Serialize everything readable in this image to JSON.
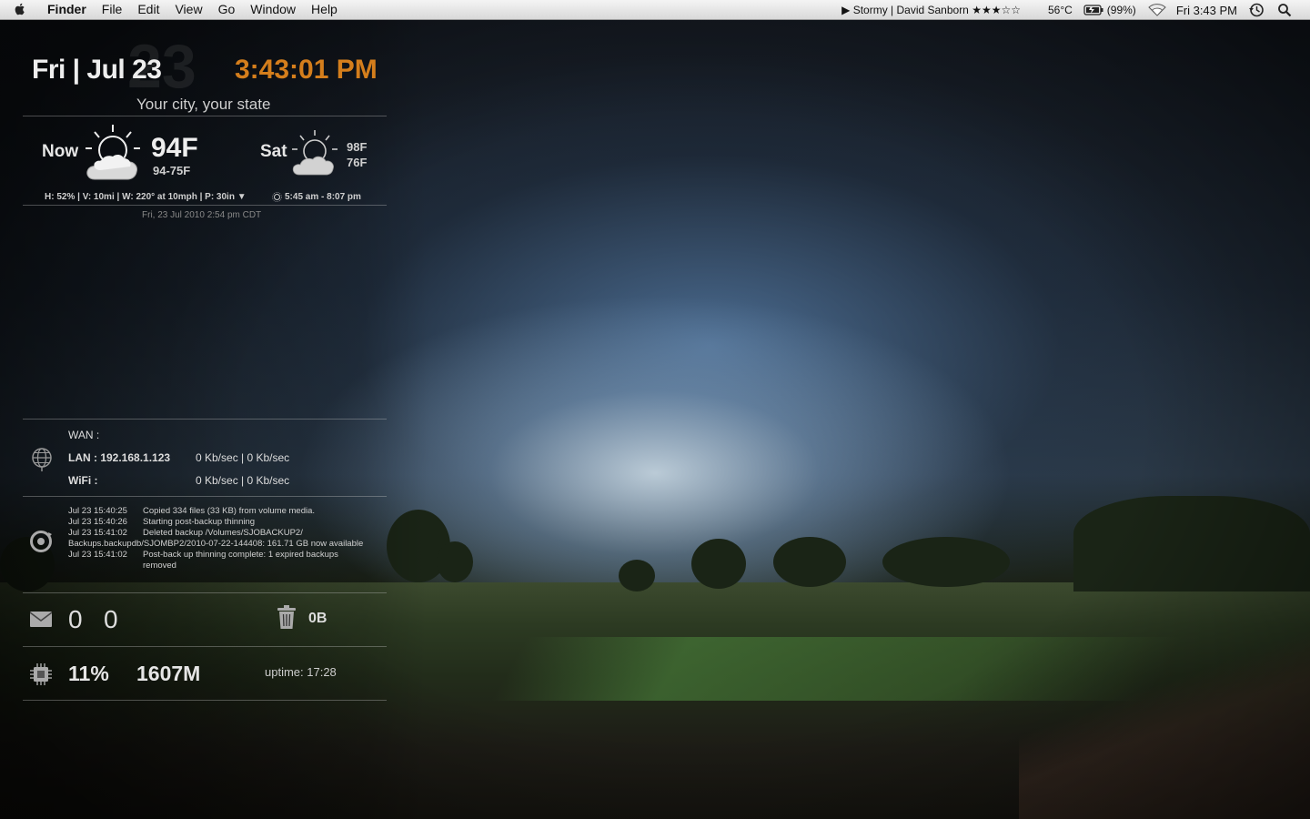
{
  "menubar": {
    "app": "Finder",
    "menus": [
      "File",
      "Edit",
      "View",
      "Go",
      "Window",
      "Help"
    ],
    "now_playing": "▶ Stormy | David Sanborn ★★★☆☆",
    "cpu_temp": "56°C",
    "battery": "(99%)",
    "datetime": "Fri 3:43 PM"
  },
  "clock": {
    "date": "Fri | Jul 23",
    "big_day": "23",
    "time": "3:43:01 PM",
    "location": "Your city, your state"
  },
  "weather": {
    "now_label": "Now",
    "now_temp": "94F",
    "now_range": "94-75F",
    "next_label": "Sat",
    "next_high": "98F",
    "next_low": "76F",
    "details": "H: 52% | V: 10mi | W: 220° at 10mph | P: 30in ▼",
    "sun_times": "5:45 am - 8:07 pm",
    "updated": "Fri, 23 Jul 2010 2:54 pm CDT"
  },
  "network": {
    "wan_label": "WAN :",
    "lan_label": "LAN : 192.168.1.123",
    "lan_rate": "0 Kb/sec | 0 Kb/sec",
    "wifi_label": "WiFi :",
    "wifi_rate": "0 Kb/sec | 0 Kb/sec"
  },
  "backup_log": [
    {
      "time": "Jul 23 15:40:25",
      "text": "Copied 334 files (33 KB) from volume media."
    },
    {
      "time": "Jul 23 15:40:26",
      "text": "Starting post-backup thinning"
    },
    {
      "time": "Jul 23 15:41:02",
      "text": "Deleted backup /Volumes/SJOBACKUP2/"
    },
    {
      "time": "",
      "text": "Backups.backupdb/SJOMBP2/2010-07-22-144408: 161.71 GB now available"
    },
    {
      "time": "Jul 23 15:41:02",
      "text": "Post-back up thinning complete: 1 expired backups removed"
    }
  ],
  "mail": {
    "unread": "0",
    "total": "0"
  },
  "trash": {
    "size": "0B"
  },
  "system": {
    "cpu": "11%",
    "memory": "1607M",
    "uptime": "uptime: 17:28"
  },
  "icons": [
    "apple-icon",
    "play-icon",
    "battery-icon",
    "wifi-icon",
    "time-machine-icon",
    "spotlight-icon",
    "weather-partly-cloudy-icon",
    "sun-icon",
    "globe-icon",
    "backup-icon",
    "mail-icon",
    "trash-icon",
    "cpu-icon"
  ]
}
